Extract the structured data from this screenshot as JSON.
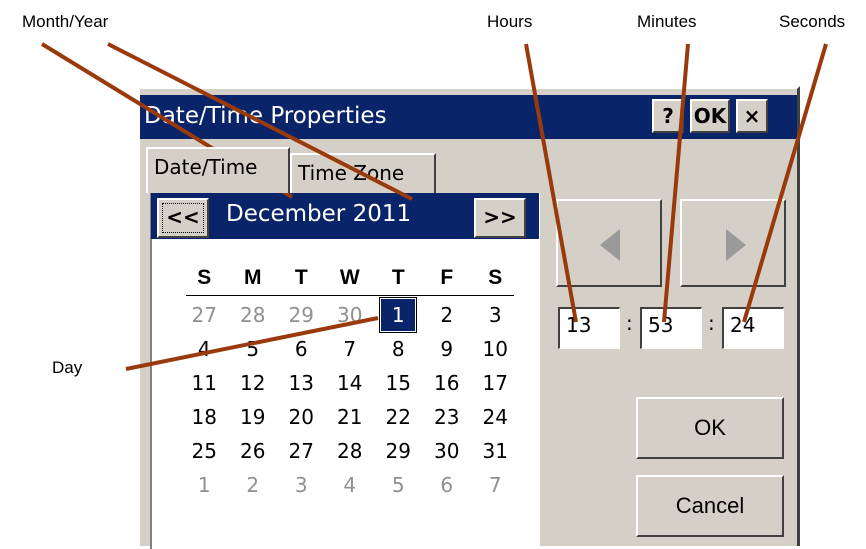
{
  "annotations": {
    "month_year": "Month/Year",
    "hours": "Hours",
    "minutes": "Minutes",
    "seconds": "Seconds",
    "day": "Day"
  },
  "window": {
    "title": "Date/Time Properties",
    "help_button": "?",
    "ok_button": "OK",
    "close_button": "×"
  },
  "tabs": [
    {
      "label": "Date/Time",
      "active": true
    },
    {
      "label": "Time Zone",
      "active": false
    }
  ],
  "calendar": {
    "prev_label": "<<",
    "next_label": ">>",
    "month_year": "December 2011",
    "weekdays": [
      "S",
      "M",
      "T",
      "W",
      "T",
      "F",
      "S"
    ],
    "weeks": [
      [
        "27",
        "28",
        "29",
        "30",
        "1",
        "2",
        "3"
      ],
      [
        "4",
        "5",
        "6",
        "7",
        "8",
        "9",
        "10"
      ],
      [
        "11",
        "12",
        "13",
        "14",
        "15",
        "16",
        "17"
      ],
      [
        "18",
        "19",
        "20",
        "21",
        "22",
        "23",
        "24"
      ],
      [
        "25",
        "26",
        "27",
        "28",
        "29",
        "30",
        "31"
      ],
      [
        "1",
        "2",
        "3",
        "4",
        "5",
        "6",
        "7"
      ]
    ],
    "selected_day": "1"
  },
  "time": {
    "hours": "13",
    "minutes": "53",
    "seconds": "24",
    "separator": ":"
  },
  "buttons": {
    "ok": "OK",
    "cancel": "Cancel"
  },
  "colors": {
    "titlebar": "#0a246a",
    "face": "#d4d0c8",
    "callout_line": "#9a3a0c"
  }
}
